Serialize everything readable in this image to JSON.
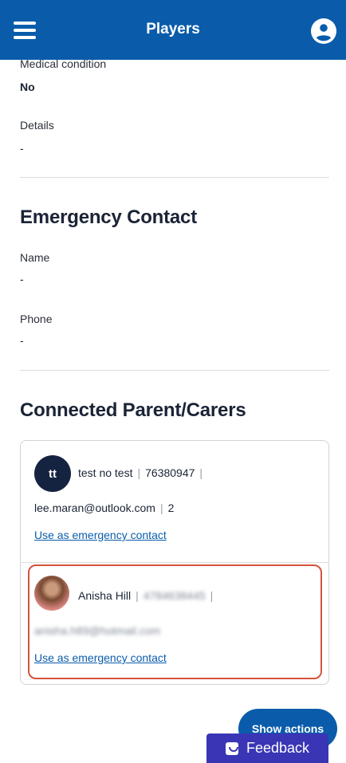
{
  "header": {
    "title": "Players"
  },
  "medical": {
    "condition_label": "Medical condition",
    "condition_value": "No",
    "details_label": "Details",
    "details_value": "-"
  },
  "emergency": {
    "title": "Emergency Contact",
    "name_label": "Name",
    "name_value": "-",
    "phone_label": "Phone",
    "phone_value": "-"
  },
  "carers": {
    "title": "Connected Parent/Carers",
    "items": [
      {
        "initials": "tt",
        "name": "test no test",
        "phone": "76380947",
        "email": "lee.maran@outlook.com",
        "extra": "2",
        "link": "Use as emergency contact"
      },
      {
        "name": "Anisha Hill",
        "phone": "4784638445",
        "email": "anisha.h89@hotmail.com",
        "link": "Use as emergency contact"
      }
    ]
  },
  "actions": {
    "show_actions": "Show actions",
    "feedback": "Feedback"
  },
  "colors": {
    "brand": "#0a5cab",
    "highlight": "#d5533c",
    "feedback": "#3a35b5"
  }
}
